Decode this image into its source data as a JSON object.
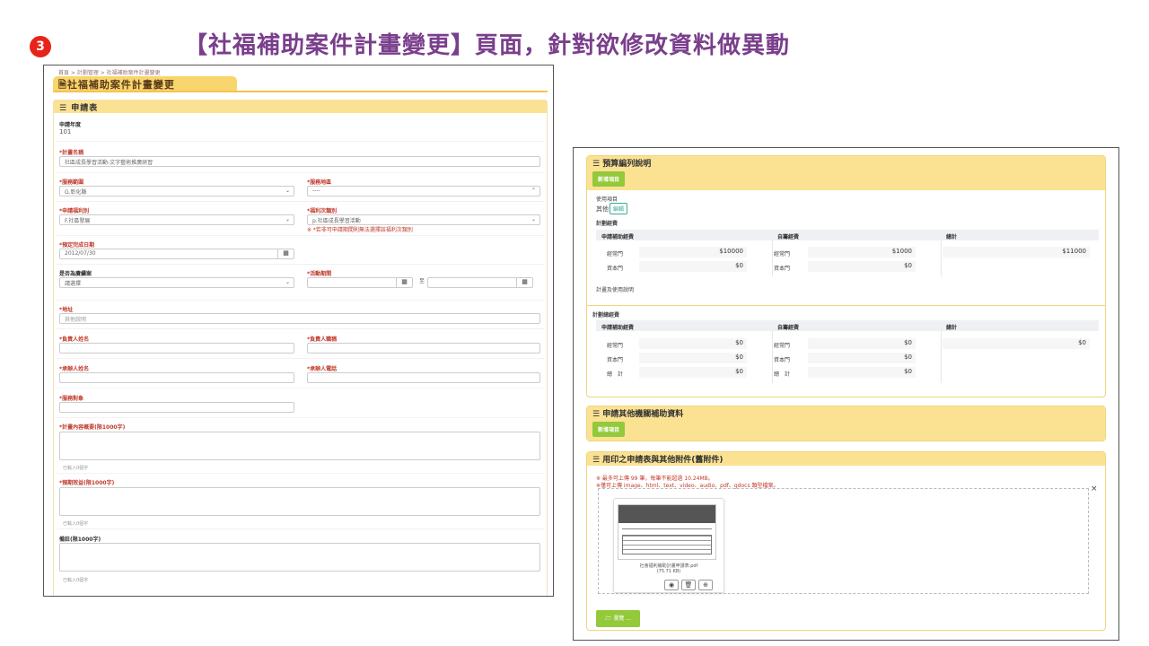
{
  "slide": {
    "title": "【社福補助案件計畫變更】頁面，針對欲修改資料做異動",
    "step_number": "3"
  },
  "left": {
    "breadcrumb": "首頁 > 計劃管理 > 社福補助案件計畫變更",
    "page_title": "社福補助案件計畫變更",
    "section_title": "申請表",
    "fields": {
      "year_label": "申請年度",
      "year_value": "101",
      "plan_name_label": "*計畫名稱",
      "plan_name_value": "社區成長學習活動-文字藝術推廣研習",
      "service_scope_label": "*服務範圍",
      "service_scope_value": "G.彰化縣",
      "service_area_label": "*服務地區",
      "service_area_value": "----",
      "welfare_type_label": "*申請福利別",
      "welfare_type_value": "F.社區發展",
      "welfare_subtype_label": "*福利次類別",
      "welfare_subtype_value": "p.社區成長學習活動",
      "welfare_subtype_note": "※ *若非可申請期間則無法選擇該福利次類別",
      "due_date_label": "*預定完成日期",
      "due_date_value": "2012/07/30",
      "continuation_label": "是否為賡續案",
      "continuation_value": "請選擇",
      "activity_period_label": "*活動期間",
      "activity_period_to": "至",
      "address_label": "*地址",
      "address_placeholder": "其他說明",
      "person_name_label": "*負責人姓名",
      "person_title_label": "*負責人職稱",
      "handler_name_label": "*承辦人姓名",
      "handler_phone_label": "*承辦人電話",
      "service_target_label": "*服務對象",
      "summary_label": "*計畫內容概要(限1000字)",
      "summary_count": "已輸入0個字",
      "benefit_label": "*預期效益(限1000字)",
      "benefit_count": "已輸入0個字",
      "remarks_label": "備註(限1000字)",
      "remarks_count": "已輸入0個字"
    }
  },
  "right": {
    "budget": {
      "title": "預算編列說明",
      "add_button": "新增項目",
      "usage_label": "使用項目",
      "usage_value": "其他",
      "edit_button": "編輯",
      "plan_funds_label": "計劃經費",
      "col_apply": "申請補助經費",
      "col_self": "自籌經費",
      "col_total": "總計",
      "row_regular": "經常門",
      "row_capital": "資本門",
      "apply_regular": "$10000",
      "apply_capital": "$0",
      "self_regular": "$1000",
      "self_capital": "$0",
      "total": "$11000",
      "usage_desc_label": "計畫及使用說明",
      "total_funds_label": "計劃總經費",
      "t_apply_regular": "$0",
      "t_apply_capital": "$0",
      "t_apply_sum": "$0",
      "t_self_regular": "$0",
      "t_self_capital": "$0",
      "t_self_sum": "$0",
      "row_sum": "總　計",
      "t_total": "$0"
    },
    "other_agency": {
      "title": "申請其他機關補助資料",
      "add_button": "新增項目"
    },
    "attachments": {
      "title": "用印之申請表與其他附件(舊附件)",
      "note1": "※ 最多可上傳 99 筆，每筆不能超過 10.24MB。",
      "note2": "※僅可上傳 image、html、text、video、audio、pdf、gdocs 類型檔案。",
      "file_name": "社會福利補助計畫申請表.pdf",
      "file_size": "(75.71 KB)",
      "browse_button": "瀏覽 ..."
    }
  },
  "colors": {
    "accent_yellow": "#fbe293",
    "tab_yellow": "#f8d56d",
    "required_red": "#c0392b",
    "green_button": "#93c93a",
    "title_purple": "#7a3f8c"
  }
}
